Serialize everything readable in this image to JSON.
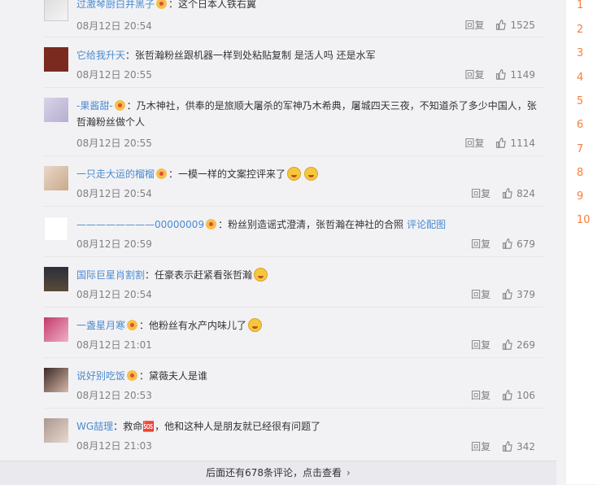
{
  "comments": [
    {
      "user": "过激琴厨白井黑子",
      "text": "这个日本人铁右翼",
      "time": "08月12日 20:54",
      "reply": "回复",
      "likes": "1525"
    },
    {
      "user": "它给我升天",
      "text": "张哲瀚粉丝跟机器一样到处粘贴复制 是活人吗 还是水军",
      "time": "08月12日 20:55",
      "reply": "回复",
      "likes": "1149"
    },
    {
      "user": "-果酱甜-",
      "text": "乃木神社，供奉的是旅顺大屠杀的军神乃木希典，屠城四天三夜，不知道杀了多少中国人，张哲瀚粉丝做个人",
      "time": "08月12日 20:55",
      "reply": "回复",
      "likes": "1114"
    },
    {
      "user": "一只走大运的榴榴",
      "text": "一模一样的文案控评来了",
      "time": "08月12日 20:54",
      "reply": "回复",
      "likes": "824"
    },
    {
      "user": "————————00000009",
      "text": "粉丝别造谣式澄清，张哲瀚在神社的合照",
      "link": "评论配图",
      "time": "08月12日 20:59",
      "reply": "回复",
      "likes": "679"
    },
    {
      "user": "国际巨星肖割割",
      "text": "任豪表示赶紧看张哲瀚",
      "time": "08月12日 20:54",
      "reply": "回复",
      "likes": "379"
    },
    {
      "user": "一盏星月寒",
      "text": "他粉丝有水产内味儿了",
      "time": "08月12日 21:01",
      "reply": "回复",
      "likes": "269"
    },
    {
      "user": "说好别吃饭",
      "text": "黛薇夫人是谁",
      "time": "08月12日 20:53",
      "reply": "回复",
      "likes": "106"
    },
    {
      "user": "WG喆理",
      "text": "救命🆘，他和这种人是朋友就已经很有问题了",
      "time": "08月12日 21:03",
      "reply": "回复",
      "likes": "342"
    }
  ],
  "separator": "：",
  "more_text": "后面还有678条评论，点击查看",
  "more_arrow": "›",
  "sidebar": [
    "1",
    "2",
    "3",
    "4",
    "5",
    "6",
    "7",
    "8",
    "9",
    "10"
  ],
  "colors": {
    "username": "#eb7350",
    "link": "#4a8bd0",
    "rank": "#fa7d3c"
  },
  "icons": [
    "crown-badge-icon",
    "thumbs-up-icon",
    "emoji-face-icon",
    "chevron-right-icon"
  ]
}
